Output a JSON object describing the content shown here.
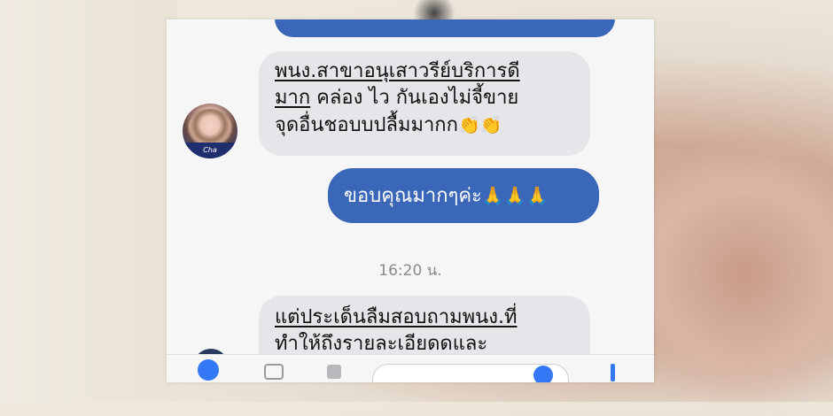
{
  "chat": {
    "incoming_1": {
      "line1": "พนง.สาขาอนุเสาวรีย์บริการดี",
      "line2_underlined": "มาก",
      "line2_rest": " คล่อง ไว กันเองไม่จี้ขาย",
      "line3": "จุดอื่นชอบบปลื้มมากก",
      "emoji": "👏👏"
    },
    "outgoing_1": {
      "text": "ขอบคุณมากๆค่ะ",
      "emoji": "🙏🙏🙏"
    },
    "timestamp": "16:20 น.",
    "incoming_2": {
      "line1": "แต่ประเด็นลืมสอบถามพนง.ที่",
      "line2": "ทำให้ถึงรายละเอียดดและ"
    },
    "avatar_caption": "Cha"
  },
  "colors": {
    "bubble_out": "#3a67b8",
    "bubble_in": "#e5e5ea",
    "accent_blue": "#3478f6"
  },
  "icons": [
    "camera-icon",
    "image-icon",
    "mic-icon",
    "emoji-icon",
    "thumbs-up-icon"
  ]
}
